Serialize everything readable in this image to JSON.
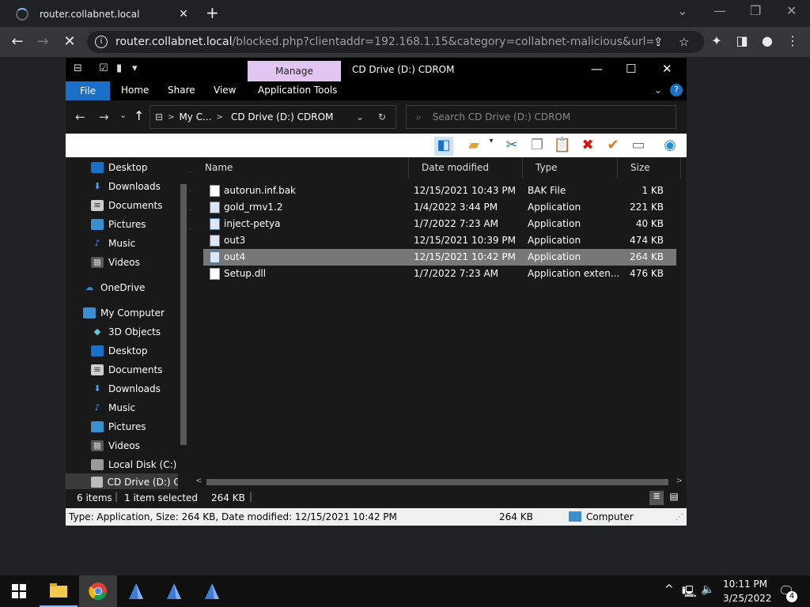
{
  "browser": {
    "tab_title": "router.collabnet.local",
    "url_host": "router.collabnet.local",
    "url_path": "/blocked.php?clientaddr=192.168.1.15&category=collabnet-malicious&url=github.co..."
  },
  "explorer": {
    "manage_label": "Manage",
    "window_title": "CD Drive (D:) CDROM",
    "ribbon_tabs": [
      "File",
      "Home",
      "Share",
      "View",
      "Application Tools"
    ],
    "address_crumbs": [
      "My C...",
      "CD Drive (D:) CDROM"
    ],
    "search_placeholder": "Search CD Drive (D:) CDROM",
    "nav_items": [
      {
        "label": "Desktop",
        "pinned": true
      },
      {
        "label": "Downloads",
        "pinned": true
      },
      {
        "label": "Documents",
        "pinned": true
      },
      {
        "label": "Pictures",
        "pinned": true
      },
      {
        "label": "Music",
        "pinned": false
      },
      {
        "label": "Videos",
        "pinned": false
      },
      {
        "label": "OneDrive",
        "pinned": false
      },
      {
        "label": "My Computer",
        "pinned": false
      },
      {
        "label": "3D Objects",
        "pinned": false
      },
      {
        "label": "Desktop",
        "pinned": false
      },
      {
        "label": "Documents",
        "pinned": false
      },
      {
        "label": "Downloads",
        "pinned": false
      },
      {
        "label": "Music",
        "pinned": false
      },
      {
        "label": "Pictures",
        "pinned": false
      },
      {
        "label": "Videos",
        "pinned": false
      },
      {
        "label": "Local Disk (C:)",
        "pinned": false
      },
      {
        "label": "CD Drive (D:) CD",
        "pinned": false
      }
    ],
    "columns": [
      "Name",
      "Date modified",
      "Type",
      "Size"
    ],
    "files": [
      {
        "name": "autorun.inf.bak",
        "date": "12/15/2021 10:43 PM",
        "type": "BAK File",
        "size": "1 KB"
      },
      {
        "name": "gold_rmv1.2",
        "date": "1/4/2022 3:44 PM",
        "type": "Application",
        "size": "221 KB"
      },
      {
        "name": "inject-petya",
        "date": "1/7/2022 7:23 AM",
        "type": "Application",
        "size": "40 KB"
      },
      {
        "name": "out3",
        "date": "12/15/2021 10:39 PM",
        "type": "Application",
        "size": "474 KB"
      },
      {
        "name": "out4",
        "date": "12/15/2021 10:42 PM",
        "type": "Application",
        "size": "264 KB"
      },
      {
        "name": "Setup.dll",
        "date": "1/7/2022 7:23 AM",
        "type": "Application exten...",
        "size": "476 KB"
      }
    ],
    "status": {
      "items": "6 items",
      "selected": "1 item selected",
      "selected_size": "264 KB"
    },
    "infobar": {
      "details": "Type: Application, Size: 264 KB, Date modified: 12/15/2021 10:42 PM",
      "size": "264 KB",
      "location": "Computer"
    }
  },
  "taskbar": {
    "time": "10:11 PM",
    "date": "3/25/2022",
    "notification_count": "4"
  }
}
